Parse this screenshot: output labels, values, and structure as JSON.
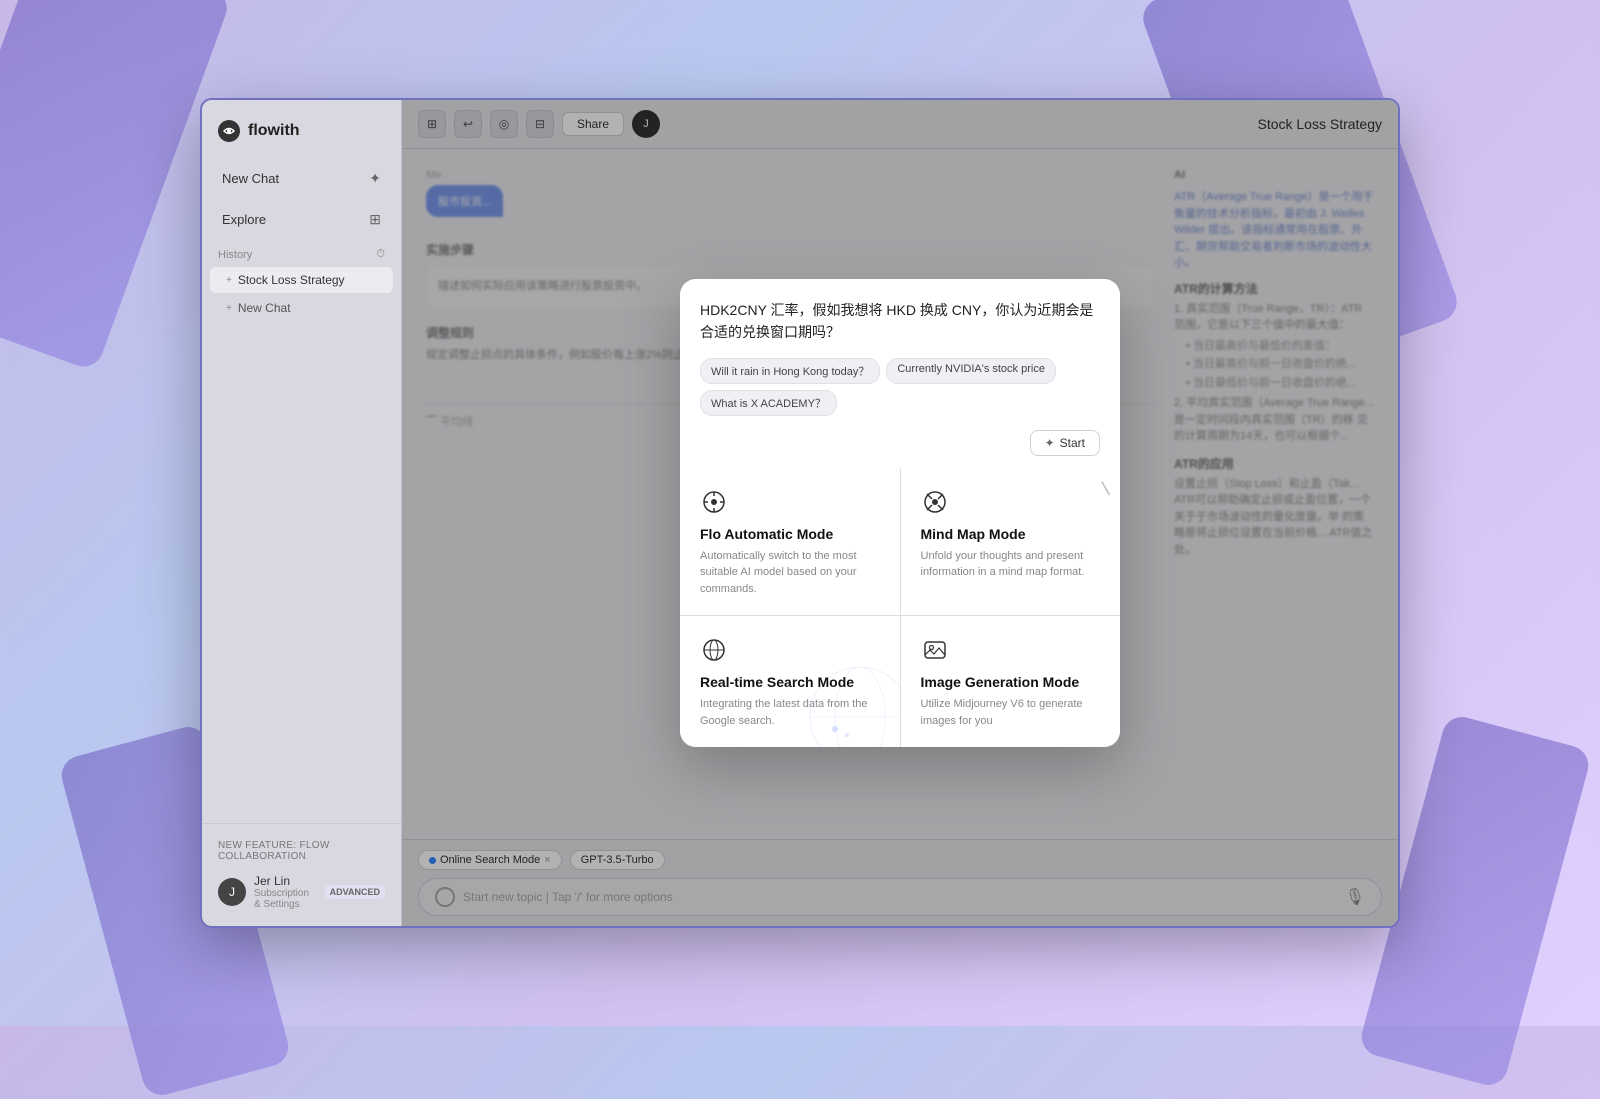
{
  "background": {
    "gradient": "linear-gradient(135deg, #c8b8e8, #d0c0f0)"
  },
  "app": {
    "title": "flowith",
    "logo_symbol": "n"
  },
  "sidebar": {
    "new_chat_btn": "New Chat",
    "explore_btn": "Explore",
    "history_label": "History",
    "history_icon": "⏱",
    "items": [
      {
        "label": "Stock Loss Strategy",
        "active": true
      },
      {
        "label": "New Chat",
        "active": false
      }
    ],
    "feature_banner": "NEW FEATURE: Flow Collaboration",
    "user": {
      "name": "Jer Lin",
      "subtitle": "Subscription & Settings",
      "badge": "ADVANCED",
      "avatar_initials": "J"
    }
  },
  "toolbar": {
    "buttons": [
      "⊞",
      "↩",
      "◎",
      "⊟"
    ],
    "share_label": "Share",
    "page_title": "Stock Loss Strategy"
  },
  "chat": {
    "me_label": "Me",
    "bubble_text": "股市投资...",
    "step_label": "实施步骤",
    "step_content": "描述如何实际应用该策略进行股票投资中。",
    "rule_label": "调整规则",
    "rule_content": "规定调整止损点的具体条件，例如股价每上涨2%则止损点上调1%。",
    "right_label": "AI",
    "right_content": [
      "ATR（Average True Range）是一个用于衡量的技术分析指标，最初由 J. Welles Wilder 提出。该指标通常用在股票、外汇、期货帮助交易者判断市场的波动性大小。",
      "ATR的计算方法",
      "ATR的应用"
    ]
  },
  "bottom_bar": {
    "tag1": "Online Search Mode",
    "tag2": "GPT-3.5-Turbo",
    "input_placeholder": "Start new topic | Tap '/' for more options"
  },
  "modal": {
    "question_text": "HDK2CNY 汇率，假如我想将 HKD 换成 CNY，你认为近期会是合适的兑换窗口期吗？",
    "suggestions": [
      "Will it rain in Hong Kong today？",
      "Currently NVIDIA's stock price",
      "What is X ACADEMY？"
    ],
    "start_label": "Start",
    "modes": [
      {
        "id": "flo-automatic",
        "icon": "⊕",
        "title": "Flo Automatic Mode",
        "description": "Automatically switch to the most suitable AI model based on your commands."
      },
      {
        "id": "mind-map",
        "icon": "⊕",
        "title": "Mind Map Mode",
        "description": "Unfold your thoughts and present information in a mind map format."
      },
      {
        "id": "real-time-search",
        "icon": "⊕",
        "title": "Real-time Search Mode",
        "description": "Integrating the latest data from the Google search."
      },
      {
        "id": "image-generation",
        "icon": "⊕",
        "title": "Image Generation Mode",
        "description": "Utilize Midjourney V6 to generate images for you"
      }
    ]
  }
}
